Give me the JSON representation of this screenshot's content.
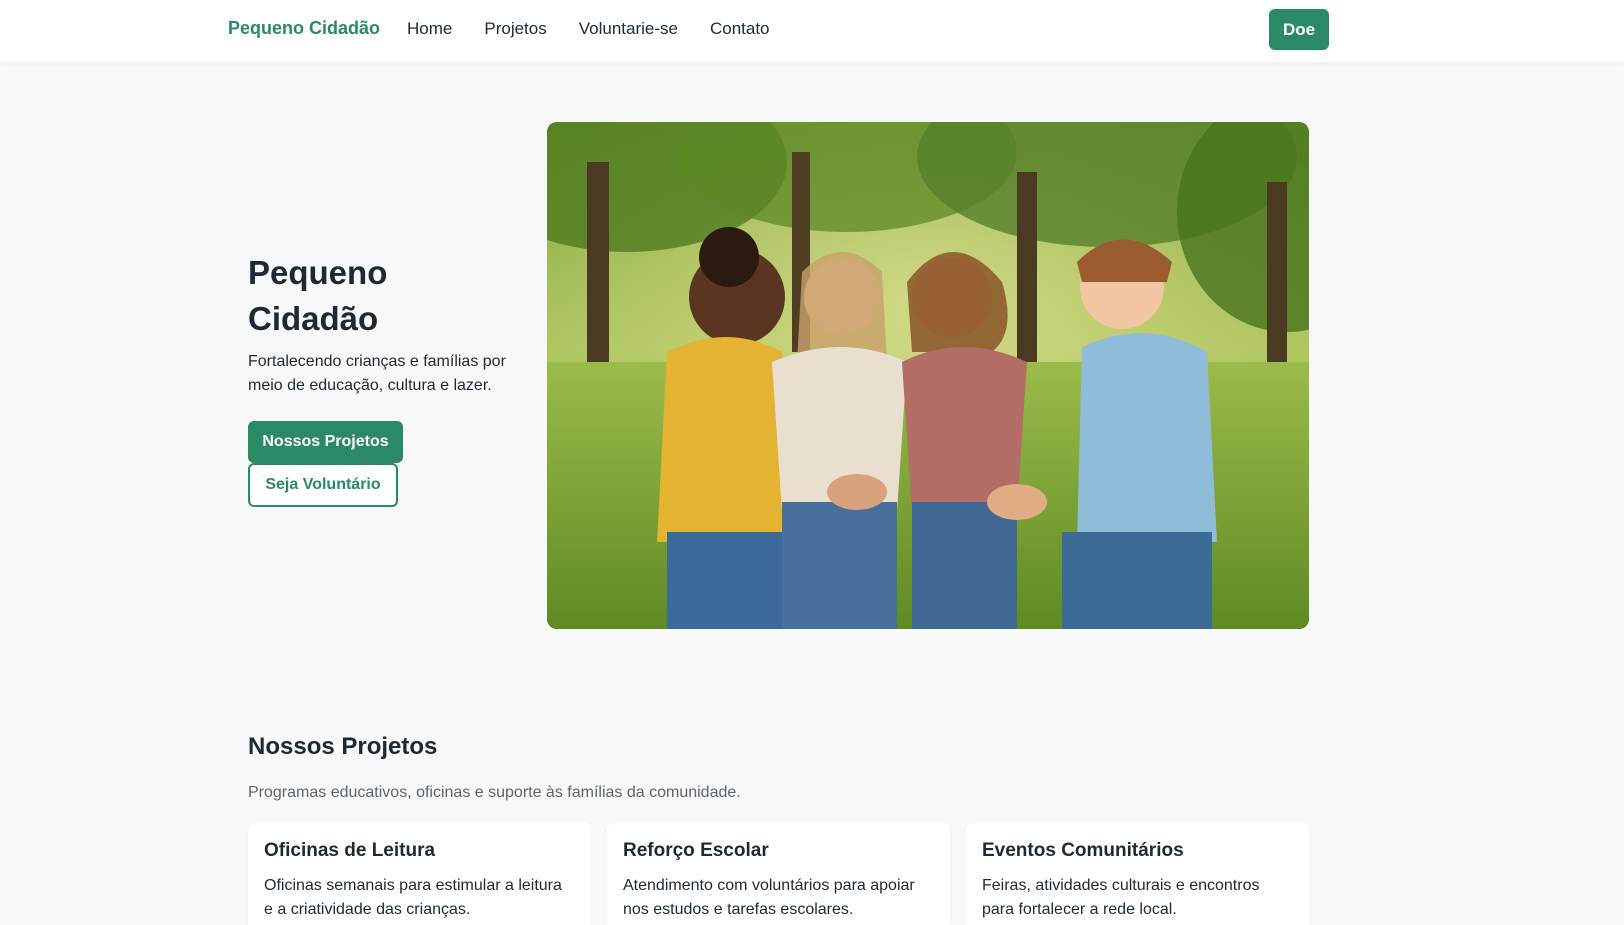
{
  "nav": {
    "brand": "Pequeno Cidadão",
    "links": [
      "Home",
      "Projetos",
      "Voluntarie-se",
      "Contato"
    ],
    "donate_label": "Doe"
  },
  "hero": {
    "title": "Pequeno Cidadão",
    "subtitle": "Fortalecendo crianças e famílias por meio de educação, cultura e lazer.",
    "primary_button": "Nossos Projetos",
    "secondary_button": "Seja Voluntário"
  },
  "projects": {
    "title": "Nossos Projetos",
    "subtitle": "Programas educativos, oficinas e suporte às famílias da comunidade.",
    "cards": [
      {
        "title": "Oficinas de Leitura",
        "text": "Oficinas semanais para estimular a leitura e a criatividade das crianças."
      },
      {
        "title": "Reforço Escolar",
        "text": "Atendimento com voluntários para apoiar nos estudos e tarefas escolares."
      },
      {
        "title": "Eventos Comunitários",
        "text": "Feiras, atividades culturais e encontros para fortalecer a rede local."
      }
    ]
  },
  "colors": {
    "brand_green": "#2a8a65",
    "background": "#f7f8f8",
    "text": "#1f2933",
    "muted": "#5b6670"
  }
}
